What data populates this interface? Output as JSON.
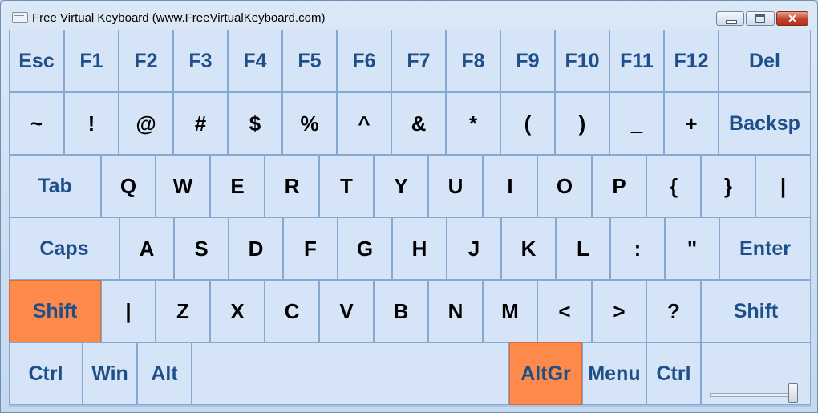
{
  "window": {
    "title": "Free Virtual Keyboard (www.FreeVirtualKeyboard.com)"
  },
  "keys": {
    "esc": "Esc",
    "f1": "F1",
    "f2": "F2",
    "f3": "F3",
    "f4": "F4",
    "f5": "F5",
    "f6": "F6",
    "f7": "F7",
    "f8": "F8",
    "f9": "F9",
    "f10": "F10",
    "f11": "F11",
    "f12": "F12",
    "del": "Del",
    "tilde": "~",
    "excl": "!",
    "at": "@",
    "hash": "#",
    "dollar": "$",
    "percent": "%",
    "caret": "^",
    "amp": "&",
    "star": "*",
    "lparen": "(",
    "rparen": ")",
    "underscore": "_",
    "plus": "+",
    "backsp": "Backsp",
    "tab": "Tab",
    "q": "Q",
    "w": "W",
    "e": "E",
    "r": "R",
    "t": "T",
    "y": "Y",
    "u": "U",
    "i": "I",
    "o": "O",
    "p": "P",
    "lbrace": "{",
    "rbrace": "}",
    "pipe": "|",
    "caps": "Caps",
    "a": "A",
    "s": "S",
    "d": "D",
    "f": "F",
    "g": "G",
    "h": "H",
    "j": "J",
    "k": "K",
    "l": "L",
    "colon": ":",
    "quote": "\"",
    "enter": "Enter",
    "lshift": "Shift",
    "pipe2": "|",
    "z": "Z",
    "x": "X",
    "c": "C",
    "v": "V",
    "b": "B",
    "n": "N",
    "m": "M",
    "lt": "<",
    "gt": ">",
    "question": "?",
    "rshift": "Shift",
    "lctrl": "Ctrl",
    "win": "Win",
    "alt": "Alt",
    "space": "",
    "altgr": "AltGr",
    "menu": "Menu",
    "rctrl": "Ctrl"
  },
  "state": {
    "active_keys": [
      "Shift",
      "AltGr"
    ]
  },
  "colors": {
    "key_bg": "#d6e4f7",
    "key_border": "#86a9d3",
    "function_text": "#1f4f89",
    "active_key": "#fd8a4a"
  },
  "transparency_slider": {
    "value_fraction": 0.95
  }
}
